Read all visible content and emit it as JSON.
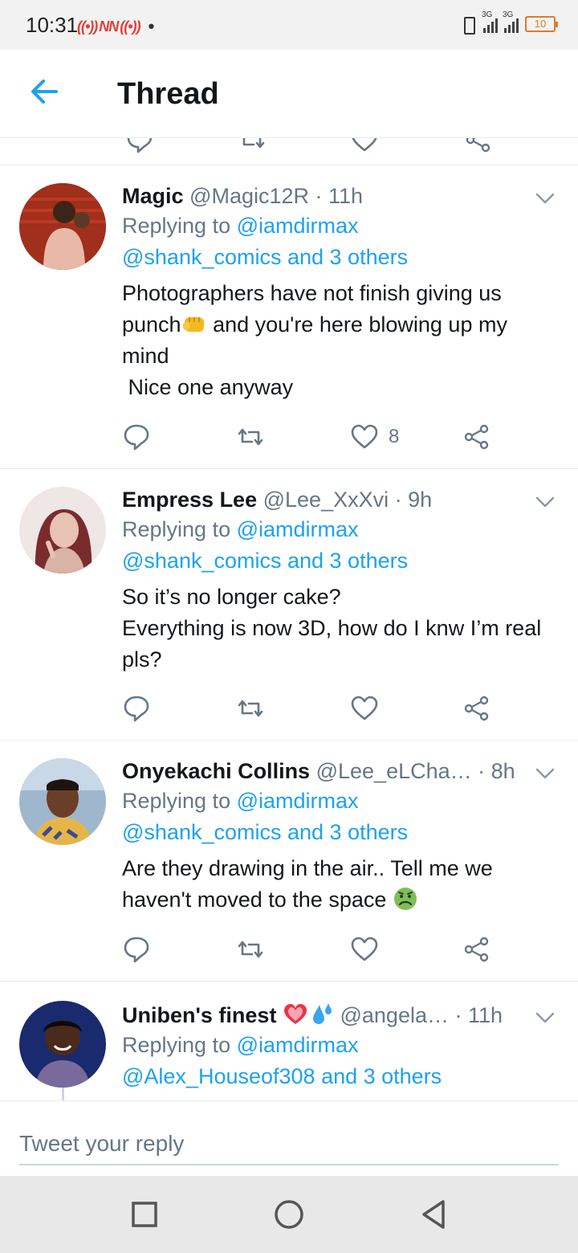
{
  "status_bar": {
    "time": "10:31",
    "network_badges": "NN",
    "signal_label_1": "3G",
    "signal_label_2": "3G",
    "battery": "10"
  },
  "header": {
    "title": "Thread"
  },
  "tweets": [
    {
      "name": "Magic",
      "handle": "@Magic12R",
      "time": "· 11h",
      "replying_prefix": "Replying to",
      "reply_to_1": "@iamdirmax",
      "reply_to_2": "@shank_comics and 3 others",
      "text_1": "Photographers have not finish giving us punch",
      "text_2": " and you're here blowing up my mind\n Nice one anyway",
      "like_count": "8",
      "emoji": "oncoming-fist"
    },
    {
      "name": "Empress Lee",
      "handle": "@Lee_XxXvi",
      "time": "· 9h",
      "replying_prefix": "Replying to",
      "reply_to_1": "@iamdirmax",
      "reply_to_2": "@shank_comics and 3 others",
      "text_1": "So it’s no longer cake?\nEverything is now 3D, how do I knw I’m real pls?",
      "like_count": ""
    },
    {
      "name": "Onyekachi Collins",
      "handle": "@Lee_eLCha…",
      "time": "· 8h",
      "replying_prefix": "Replying to",
      "reply_to_1": "@iamdirmax",
      "reply_to_2": "@shank_comics and 3 others",
      "text_1": "Are they drawing in the air.. Tell me we haven't moved to the space ",
      "like_count": "",
      "emoji": "nauseated-face"
    },
    {
      "name": "Uniben's finest",
      "handle": "@angela…",
      "time": "· 11h",
      "replying_prefix": "Replying to",
      "reply_to_1": "@iamdirmax",
      "reply_to_2": "@Alex_Houseof308 and 3 others",
      "emoji": "heart-and-sweat-droplets"
    }
  ],
  "reply_bar": {
    "placeholder": "Tweet your reply"
  },
  "colors": {
    "accent": "#1da1f2",
    "secondary_text": "#657786",
    "divider": "#e6ecf0"
  }
}
